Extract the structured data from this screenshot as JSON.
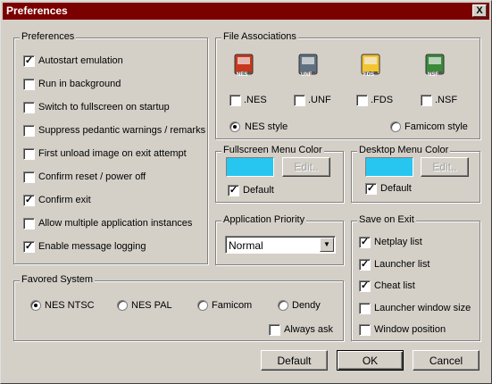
{
  "window": {
    "title": "Preferences",
    "close_glyph": "X"
  },
  "preferences": {
    "label": "Preferences",
    "items": [
      {
        "label": "Autostart emulation",
        "checked": true
      },
      {
        "label": "Run in background",
        "checked": false
      },
      {
        "label": "Switch to fullscreen on startup",
        "checked": false
      },
      {
        "label": "Suppress pedantic warnings / remarks",
        "checked": false
      },
      {
        "label": "First unload image on exit attempt",
        "checked": false
      },
      {
        "label": "Confirm reset / power off",
        "checked": false
      },
      {
        "label": "Confirm exit",
        "checked": true
      },
      {
        "label": "Allow multiple application instances",
        "checked": false
      },
      {
        "label": "Enable message logging",
        "checked": true
      }
    ]
  },
  "file_assoc": {
    "label": "File Associations",
    "types": [
      {
        "label": ".NES",
        "icon": "nes-cartridge-icon",
        "icon_text": "NES",
        "color": "#c8381c"
      },
      {
        "label": ".UNF",
        "icon": "unf-cartridge-icon",
        "icon_text": "UNF",
        "color": "#607080"
      },
      {
        "label": ".FDS",
        "icon": "fds-disk-icon",
        "icon_text": "FDS",
        "color": "#f4c430"
      },
      {
        "label": ".NSF",
        "icon": "nsf-chip-icon",
        "icon_text": "NSF",
        "color": "#3a8a3a"
      }
    ],
    "style_nes": "NES style",
    "style_famicom": "Famicom style",
    "selected_style": "nes"
  },
  "fullscreen_color": {
    "label": "Fullscreen Menu Color",
    "color": "#27c6f0",
    "edit": "Edit..",
    "default": "Default",
    "default_checked": true
  },
  "desktop_color": {
    "label": "Desktop Menu Color",
    "color": "#27c6f0",
    "edit": "Edit..",
    "default": "Default",
    "default_checked": true
  },
  "priority": {
    "label": "Application Priority",
    "value": "Normal"
  },
  "save_exit": {
    "label": "Save on Exit",
    "items": [
      {
        "label": "Netplay list",
        "checked": true
      },
      {
        "label": "Launcher list",
        "checked": true
      },
      {
        "label": "Cheat list",
        "checked": true
      },
      {
        "label": "Launcher window size",
        "checked": false
      },
      {
        "label": "Window position",
        "checked": false
      }
    ]
  },
  "favored": {
    "label": "Favored System",
    "options": [
      "NES NTSC",
      "NES PAL",
      "Famicom",
      "Dendy"
    ],
    "selected": "NES NTSC",
    "always_ask": "Always ask",
    "always_ask_checked": false
  },
  "buttons": {
    "default": "Default",
    "ok": "OK",
    "cancel": "Cancel"
  }
}
